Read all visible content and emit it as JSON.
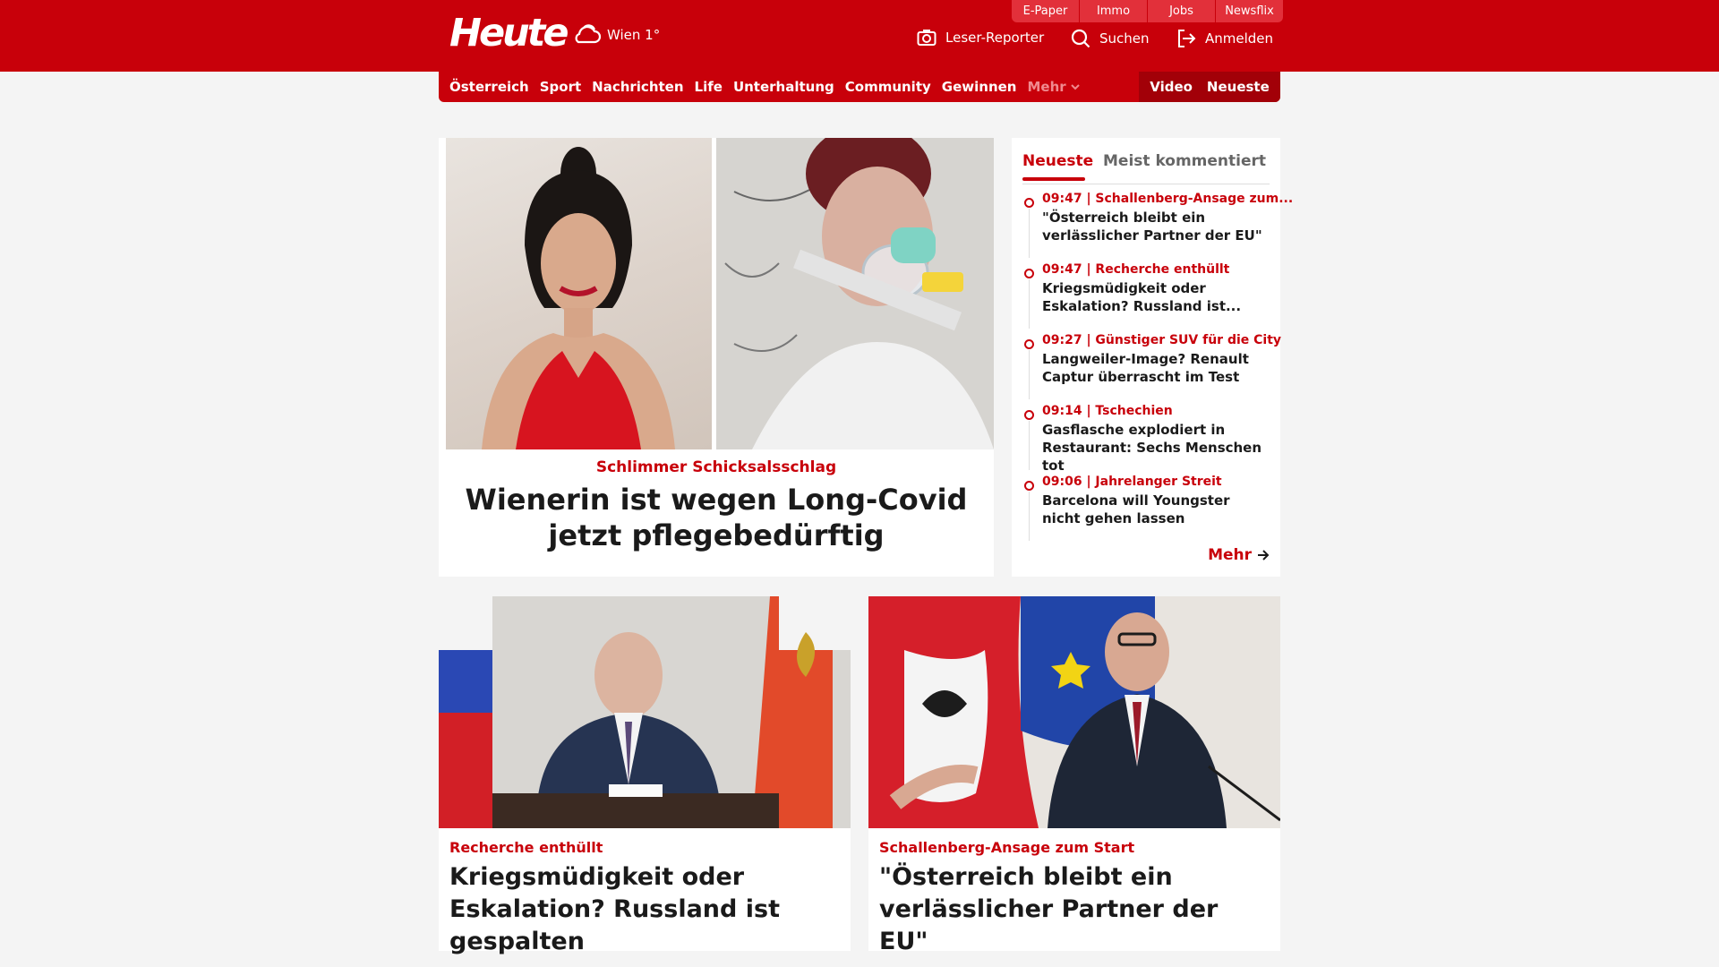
{
  "header": {
    "logo": "Heute",
    "weather": "Wien 1°",
    "top_links": [
      "E-Paper",
      "Immo",
      "Jobs",
      "Newsflix"
    ],
    "reporter_label": "Leser-Reporter",
    "search_label": "Suchen",
    "login_label": "Anmelden"
  },
  "nav": {
    "items": [
      "Österreich",
      "Sport",
      "Nachrichten",
      "Life",
      "Unterhaltung",
      "Community",
      "Gewinnen"
    ],
    "more": "Mehr",
    "video": "Video",
    "latest": "Neueste"
  },
  "hero": {
    "kicker": "Schlimmer Schicksalsschlag",
    "title": "Wienerin ist wegen Long-Covid jetzt pflegebedürftig"
  },
  "sidebar": {
    "tab_active": "Neueste",
    "tab_other": "Meist kommentiert",
    "items": [
      {
        "meta": "09:47 | Schallenberg-Ansage zum...",
        "headline": "\"Österreich bleibt ein verlässlicher Partner der EU\""
      },
      {
        "meta": "09:47 | Recherche enthüllt",
        "headline": "Kriegsmüdigkeit oder Eskalation? Russland ist..."
      },
      {
        "meta": "09:27 | Günstiger SUV für die City",
        "headline": "Langweiler-Image? Renault Captur überrascht im Test"
      },
      {
        "meta": "09:14 | Tschechien",
        "headline": "Gasflasche explodiert in Restaurant: Sechs Menschen tot"
      },
      {
        "meta": "09:06 | Jahrelanger Streit",
        "headline": "Barcelona will Youngster nicht gehen lassen"
      }
    ],
    "more": "Mehr"
  },
  "cards": [
    {
      "kicker": "Recherche enthüllt",
      "title": "Kriegsmüdigkeit oder Eskalation? Russland ist gespalten"
    },
    {
      "kicker": "Schallenberg-Ansage zum Start",
      "title": "\"Österreich bleibt ein verlässlicher Partner der EU\""
    }
  ],
  "colors": {
    "brand": "#c8000a",
    "background": "#f4f4f4"
  }
}
